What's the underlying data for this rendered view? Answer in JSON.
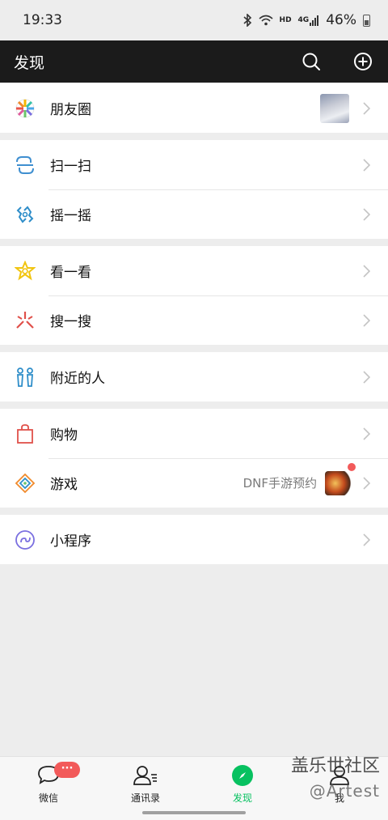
{
  "status": {
    "time": "19:33",
    "network": "HD",
    "signal": "4G",
    "battery": "46%"
  },
  "header": {
    "title": "发现"
  },
  "groups": [
    {
      "items": [
        {
          "label": "朋友圈",
          "icon": "moments-icon"
        }
      ]
    },
    {
      "items": [
        {
          "label": "扫一扫",
          "icon": "scan-icon"
        },
        {
          "label": "摇一摇",
          "icon": "shake-icon"
        }
      ]
    },
    {
      "items": [
        {
          "label": "看一看",
          "icon": "top-stories-icon"
        },
        {
          "label": "搜一搜",
          "icon": "search-icon"
        }
      ]
    },
    {
      "items": [
        {
          "label": "附近的人",
          "icon": "people-nearby-icon"
        }
      ]
    },
    {
      "items": [
        {
          "label": "购物",
          "icon": "shopping-bag-icon"
        },
        {
          "label": "游戏",
          "icon": "games-icon",
          "note": "DNF手游预约"
        }
      ]
    },
    {
      "items": [
        {
          "label": "小程序",
          "icon": "mini-programs-icon"
        }
      ]
    }
  ],
  "tabs": [
    {
      "label": "微信",
      "badge": "···"
    },
    {
      "label": "通讯录"
    },
    {
      "label": "发现"
    },
    {
      "label": "我"
    }
  ],
  "watermark": {
    "line1": "盖乐世社区",
    "line2": "@Artest"
  },
  "colors": {
    "accent": "#07c160",
    "badge": "#f25a5a",
    "header": "#1b1b1b"
  }
}
